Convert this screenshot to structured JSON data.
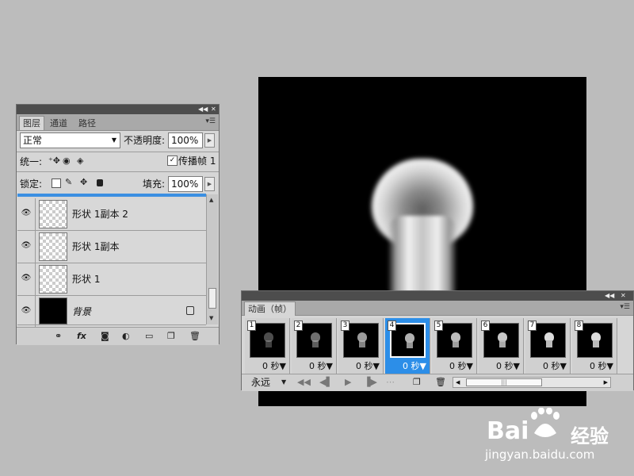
{
  "layers_panel": {
    "tabs": [
      "图层",
      "通道",
      "路径"
    ],
    "blend_mode": "正常",
    "opacity_label": "不透明度:",
    "opacity_value": "100%",
    "unify_label": "统一:",
    "propagate_label": "传播帧 1",
    "lock_label": "锁定:",
    "fill_label": "填充:",
    "fill_value": "100%",
    "layers": [
      {
        "name": "形状 1副本 2",
        "thumb": "transparent"
      },
      {
        "name": "形状 1副本",
        "thumb": "transparent"
      },
      {
        "name": "形状 1",
        "thumb": "transparent"
      },
      {
        "name": "背景",
        "thumb": "black"
      }
    ],
    "bottom_icons": [
      "link-icon",
      "fx-icon",
      "mask-icon",
      "adjustment-icon",
      "group-icon",
      "new-layer-icon",
      "delete-icon"
    ]
  },
  "animation_panel": {
    "title": "动画（帧）",
    "frames": [
      {
        "num": "1",
        "delay": "0 秒▼"
      },
      {
        "num": "2",
        "delay": "0 秒▼"
      },
      {
        "num": "3",
        "delay": "0 秒▼"
      },
      {
        "num": "4",
        "delay": "0 秒▼"
      },
      {
        "num": "5",
        "delay": "0 秒▼"
      },
      {
        "num": "6",
        "delay": "0 秒▼"
      },
      {
        "num": "7",
        "delay": "0 秒▼"
      },
      {
        "num": "8",
        "delay": "0 秒▼"
      }
    ],
    "selected_frame": "4",
    "loop": "永远"
  },
  "watermark": {
    "brand_left": "Bai",
    "brand_right": "经验",
    "url": "jingyan.baidu.com"
  },
  "colors": {
    "app_bg": "#bcbcbc",
    "panel_bg": "#d6d6d6",
    "selection": "#2c8ee8"
  }
}
